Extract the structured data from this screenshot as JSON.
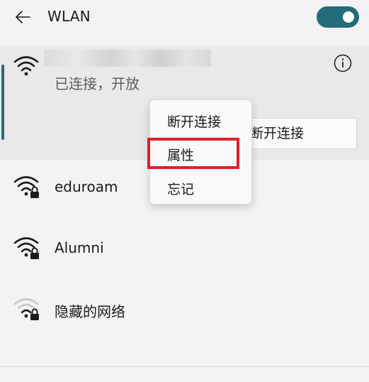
{
  "header": {
    "back_icon": "back-arrow-icon",
    "title": "WLAN",
    "toggle_on": true
  },
  "connected_network": {
    "icon": "wifi-icon",
    "status": "已连接，开放",
    "info_icon": "info-icon",
    "disconnect_label": "断开连接"
  },
  "context_menu": {
    "items": [
      "断开连接",
      "属性",
      "忘记"
    ],
    "highlighted": "属性"
  },
  "networks": [
    {
      "name": "eduroam",
      "icon": "wifi-lock-icon"
    },
    {
      "name": "Alumni",
      "icon": "wifi-lock-icon"
    },
    {
      "name": "隐藏的网络",
      "icon": "wifi-lock-weak-icon"
    }
  ],
  "colors": {
    "accent": "#236c78",
    "highlight_border": "#e0202a",
    "background": "#f3f3f3"
  }
}
